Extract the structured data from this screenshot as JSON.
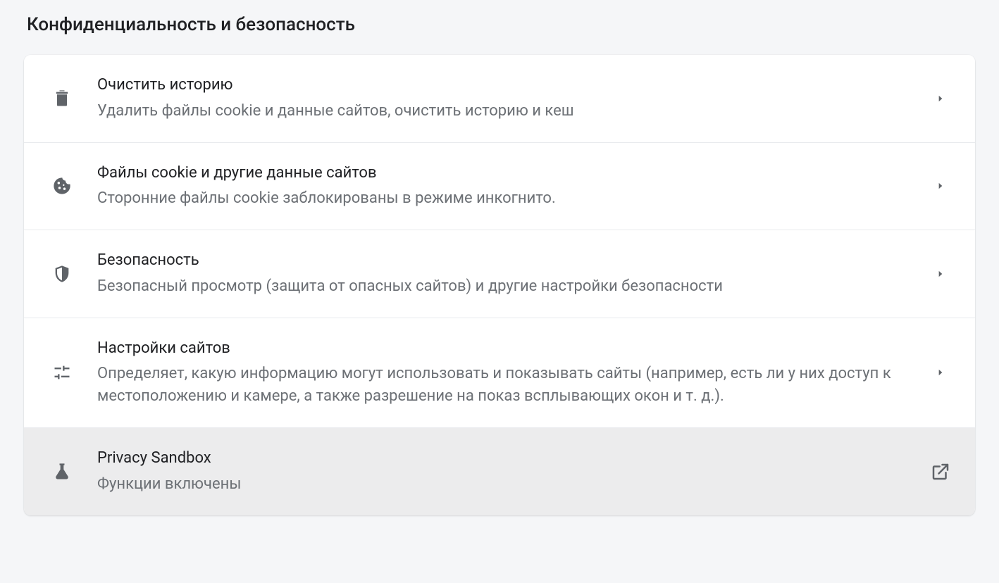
{
  "section": {
    "title": "Конфиденциальность и безопасность"
  },
  "rows": [
    {
      "title": "Очистить историю",
      "desc": "Удалить файлы cookie и данные сайтов, очистить историю и кеш"
    },
    {
      "title": "Файлы cookie и другие данные сайтов",
      "desc": "Сторонние файлы cookie заблокированы в режиме инкогнито."
    },
    {
      "title": "Безопасность",
      "desc": "Безопасный просмотр (защита от опасных сайтов) и другие настройки безопасности"
    },
    {
      "title": "Настройки сайтов",
      "desc": "Определяет, какую информацию могут использовать и показывать сайты (например, есть ли у них доступ к местоположению и камере, а также разрешение на показ всплывающих окон и т. д.)."
    },
    {
      "title": "Privacy Sandbox",
      "desc": "Функции включены"
    }
  ]
}
